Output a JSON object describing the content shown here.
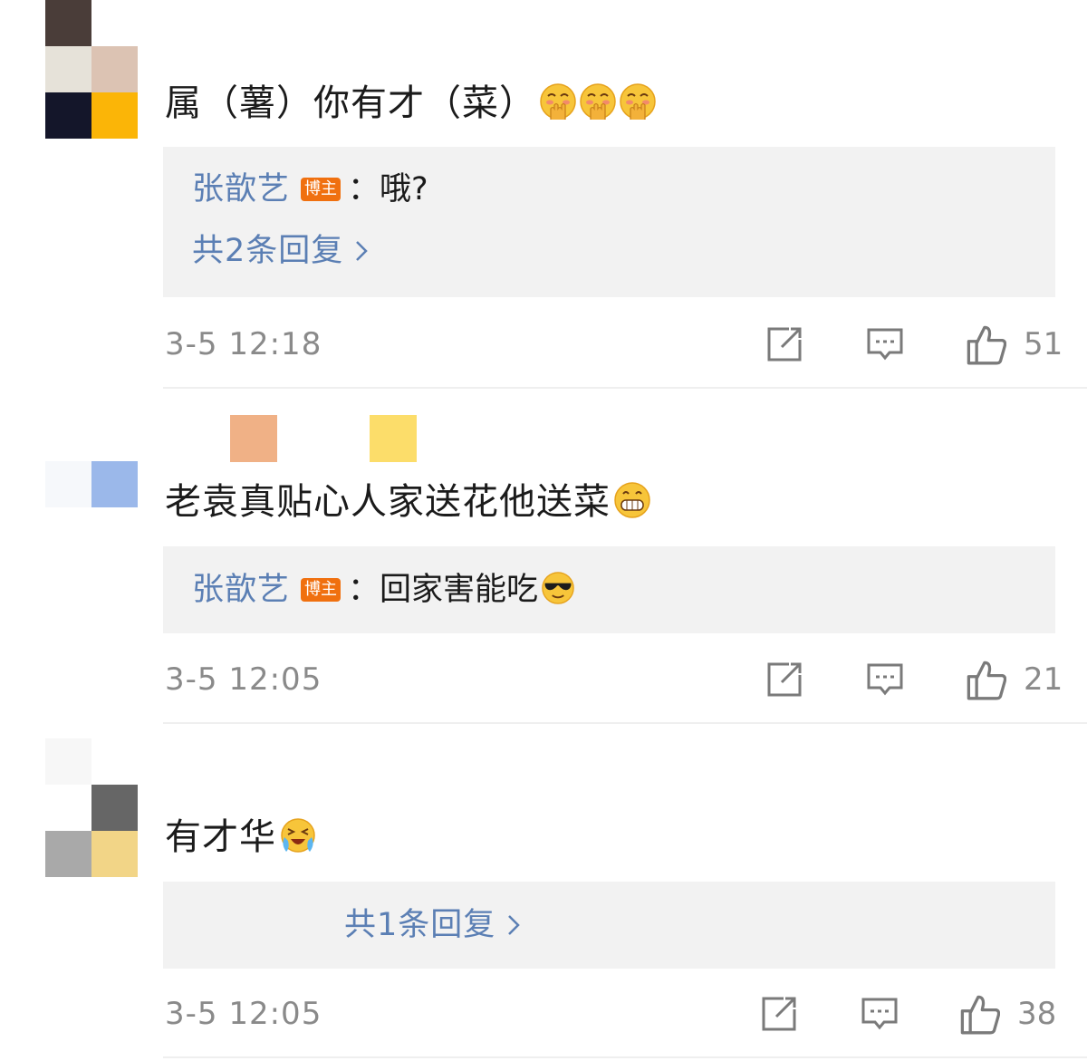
{
  "comments": [
    {
      "text": "属（薯）你有才（菜）",
      "emoji": [
        "shy-hands-emoji",
        "shy-hands-emoji",
        "shy-hands-emoji"
      ],
      "reply": {
        "author": "张歆艺",
        "badge": "博主",
        "sep": "：",
        "text": "哦?"
      },
      "more_replies": "共2条回复",
      "time": "3-5 12:18",
      "likes": "51"
    },
    {
      "text": "老袁真贴心人家送花他送菜",
      "emoji": [
        "grin-emoji"
      ],
      "reply": {
        "author": "张歆艺",
        "badge": "博主",
        "sep": "：",
        "text": "回家害能吃"
      },
      "reply_emoji": "sunglasses-emoji",
      "time": "3-5 12:05",
      "likes": "21"
    },
    {
      "text": "有才华",
      "emoji": [
        "laugh-cry-emoji"
      ],
      "more_replies": "共1条回复",
      "time": "3-5 12:05",
      "likes": "38"
    }
  ],
  "colors": {
    "link": "#5b7fb4",
    "badge": "#f0700f",
    "meta": "#8a8a8a",
    "reply_bg": "#f2f2f2"
  },
  "icons": [
    "share-icon",
    "comment-icon",
    "like-icon"
  ]
}
